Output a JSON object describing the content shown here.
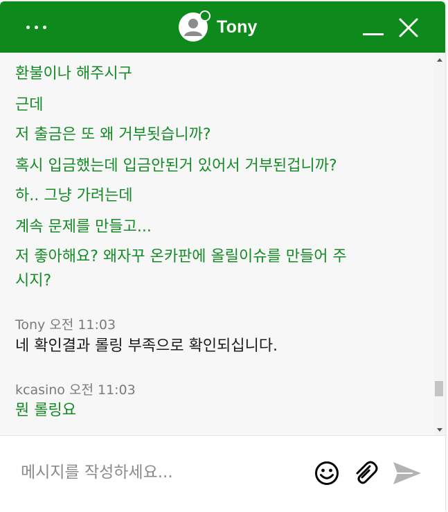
{
  "header": {
    "agent_name": "Tony",
    "menu_icon": "ellipsis-icon",
    "avatar_icon": "user-avatar-icon",
    "minimize_icon": "minimize-icon",
    "close_icon": "close-icon",
    "accent_color": "#0e8a1c"
  },
  "messages": [
    {
      "from": "customer",
      "text": "환불이나 해주시구"
    },
    {
      "from": "customer",
      "text": "근데"
    },
    {
      "from": "customer",
      "text": "저 출금은 또 왜 거부됫습니까?"
    },
    {
      "from": "customer",
      "text": "혹시 입금했는데 입금안된거 있어서 거부된겁니까?"
    },
    {
      "from": "customer",
      "text": "하.. 그냥 가려는데"
    },
    {
      "from": "customer",
      "text": "계속 문제를 만들고..."
    },
    {
      "from": "customer",
      "text_line1": "저 좋아해요? 왜자꾸 온카판에 올릴이슈를 만들어 주",
      "text_line2": "시지?"
    },
    {
      "from": "agent",
      "sender": "Tony",
      "time": "오전 11:03",
      "text": "네 확인결과 롤링 부족으로 확인되십니다."
    },
    {
      "from": "customer",
      "sender": "kcasino",
      "time": "오전 11:03",
      "text": "뭔 롤링요"
    }
  ],
  "composer": {
    "placeholder": "메시지를 작성하세요...",
    "emoji_icon": "emoji-icon",
    "attach_icon": "paperclip-icon",
    "send_icon": "send-icon"
  },
  "colors": {
    "customer_text": "#138a24",
    "agent_text": "#1a1a1a",
    "meta_text": "#7a7a7a"
  }
}
